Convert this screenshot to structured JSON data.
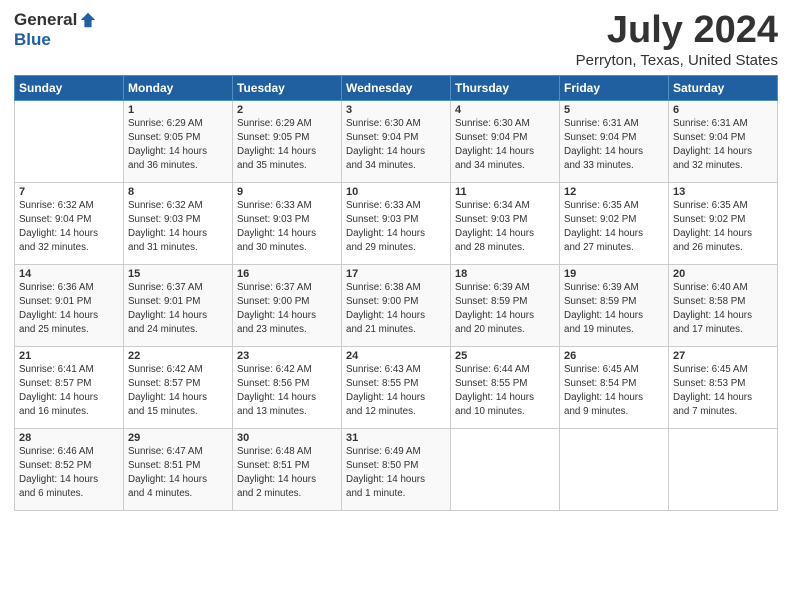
{
  "logo": {
    "general": "General",
    "blue": "Blue"
  },
  "header": {
    "title": "July 2024",
    "subtitle": "Perryton, Texas, United States"
  },
  "calendar": {
    "days_of_week": [
      "Sunday",
      "Monday",
      "Tuesday",
      "Wednesday",
      "Thursday",
      "Friday",
      "Saturday"
    ],
    "weeks": [
      [
        {
          "day": "",
          "info": ""
        },
        {
          "day": "1",
          "info": "Sunrise: 6:29 AM\nSunset: 9:05 PM\nDaylight: 14 hours\nand 36 minutes."
        },
        {
          "day": "2",
          "info": "Sunrise: 6:29 AM\nSunset: 9:05 PM\nDaylight: 14 hours\nand 35 minutes."
        },
        {
          "day": "3",
          "info": "Sunrise: 6:30 AM\nSunset: 9:04 PM\nDaylight: 14 hours\nand 34 minutes."
        },
        {
          "day": "4",
          "info": "Sunrise: 6:30 AM\nSunset: 9:04 PM\nDaylight: 14 hours\nand 34 minutes."
        },
        {
          "day": "5",
          "info": "Sunrise: 6:31 AM\nSunset: 9:04 PM\nDaylight: 14 hours\nand 33 minutes."
        },
        {
          "day": "6",
          "info": "Sunrise: 6:31 AM\nSunset: 9:04 PM\nDaylight: 14 hours\nand 32 minutes."
        }
      ],
      [
        {
          "day": "7",
          "info": "Sunrise: 6:32 AM\nSunset: 9:04 PM\nDaylight: 14 hours\nand 32 minutes."
        },
        {
          "day": "8",
          "info": "Sunrise: 6:32 AM\nSunset: 9:03 PM\nDaylight: 14 hours\nand 31 minutes."
        },
        {
          "day": "9",
          "info": "Sunrise: 6:33 AM\nSunset: 9:03 PM\nDaylight: 14 hours\nand 30 minutes."
        },
        {
          "day": "10",
          "info": "Sunrise: 6:33 AM\nSunset: 9:03 PM\nDaylight: 14 hours\nand 29 minutes."
        },
        {
          "day": "11",
          "info": "Sunrise: 6:34 AM\nSunset: 9:03 PM\nDaylight: 14 hours\nand 28 minutes."
        },
        {
          "day": "12",
          "info": "Sunrise: 6:35 AM\nSunset: 9:02 PM\nDaylight: 14 hours\nand 27 minutes."
        },
        {
          "day": "13",
          "info": "Sunrise: 6:35 AM\nSunset: 9:02 PM\nDaylight: 14 hours\nand 26 minutes."
        }
      ],
      [
        {
          "day": "14",
          "info": "Sunrise: 6:36 AM\nSunset: 9:01 PM\nDaylight: 14 hours\nand 25 minutes."
        },
        {
          "day": "15",
          "info": "Sunrise: 6:37 AM\nSunset: 9:01 PM\nDaylight: 14 hours\nand 24 minutes."
        },
        {
          "day": "16",
          "info": "Sunrise: 6:37 AM\nSunset: 9:00 PM\nDaylight: 14 hours\nand 23 minutes."
        },
        {
          "day": "17",
          "info": "Sunrise: 6:38 AM\nSunset: 9:00 PM\nDaylight: 14 hours\nand 21 minutes."
        },
        {
          "day": "18",
          "info": "Sunrise: 6:39 AM\nSunset: 8:59 PM\nDaylight: 14 hours\nand 20 minutes."
        },
        {
          "day": "19",
          "info": "Sunrise: 6:39 AM\nSunset: 8:59 PM\nDaylight: 14 hours\nand 19 minutes."
        },
        {
          "day": "20",
          "info": "Sunrise: 6:40 AM\nSunset: 8:58 PM\nDaylight: 14 hours\nand 17 minutes."
        }
      ],
      [
        {
          "day": "21",
          "info": "Sunrise: 6:41 AM\nSunset: 8:57 PM\nDaylight: 14 hours\nand 16 minutes."
        },
        {
          "day": "22",
          "info": "Sunrise: 6:42 AM\nSunset: 8:57 PM\nDaylight: 14 hours\nand 15 minutes."
        },
        {
          "day": "23",
          "info": "Sunrise: 6:42 AM\nSunset: 8:56 PM\nDaylight: 14 hours\nand 13 minutes."
        },
        {
          "day": "24",
          "info": "Sunrise: 6:43 AM\nSunset: 8:55 PM\nDaylight: 14 hours\nand 12 minutes."
        },
        {
          "day": "25",
          "info": "Sunrise: 6:44 AM\nSunset: 8:55 PM\nDaylight: 14 hours\nand 10 minutes."
        },
        {
          "day": "26",
          "info": "Sunrise: 6:45 AM\nSunset: 8:54 PM\nDaylight: 14 hours\nand 9 minutes."
        },
        {
          "day": "27",
          "info": "Sunrise: 6:45 AM\nSunset: 8:53 PM\nDaylight: 14 hours\nand 7 minutes."
        }
      ],
      [
        {
          "day": "28",
          "info": "Sunrise: 6:46 AM\nSunset: 8:52 PM\nDaylight: 14 hours\nand 6 minutes."
        },
        {
          "day": "29",
          "info": "Sunrise: 6:47 AM\nSunset: 8:51 PM\nDaylight: 14 hours\nand 4 minutes."
        },
        {
          "day": "30",
          "info": "Sunrise: 6:48 AM\nSunset: 8:51 PM\nDaylight: 14 hours\nand 2 minutes."
        },
        {
          "day": "31",
          "info": "Sunrise: 6:49 AM\nSunset: 8:50 PM\nDaylight: 14 hours\nand 1 minute."
        },
        {
          "day": "",
          "info": ""
        },
        {
          "day": "",
          "info": ""
        },
        {
          "day": "",
          "info": ""
        }
      ]
    ]
  }
}
